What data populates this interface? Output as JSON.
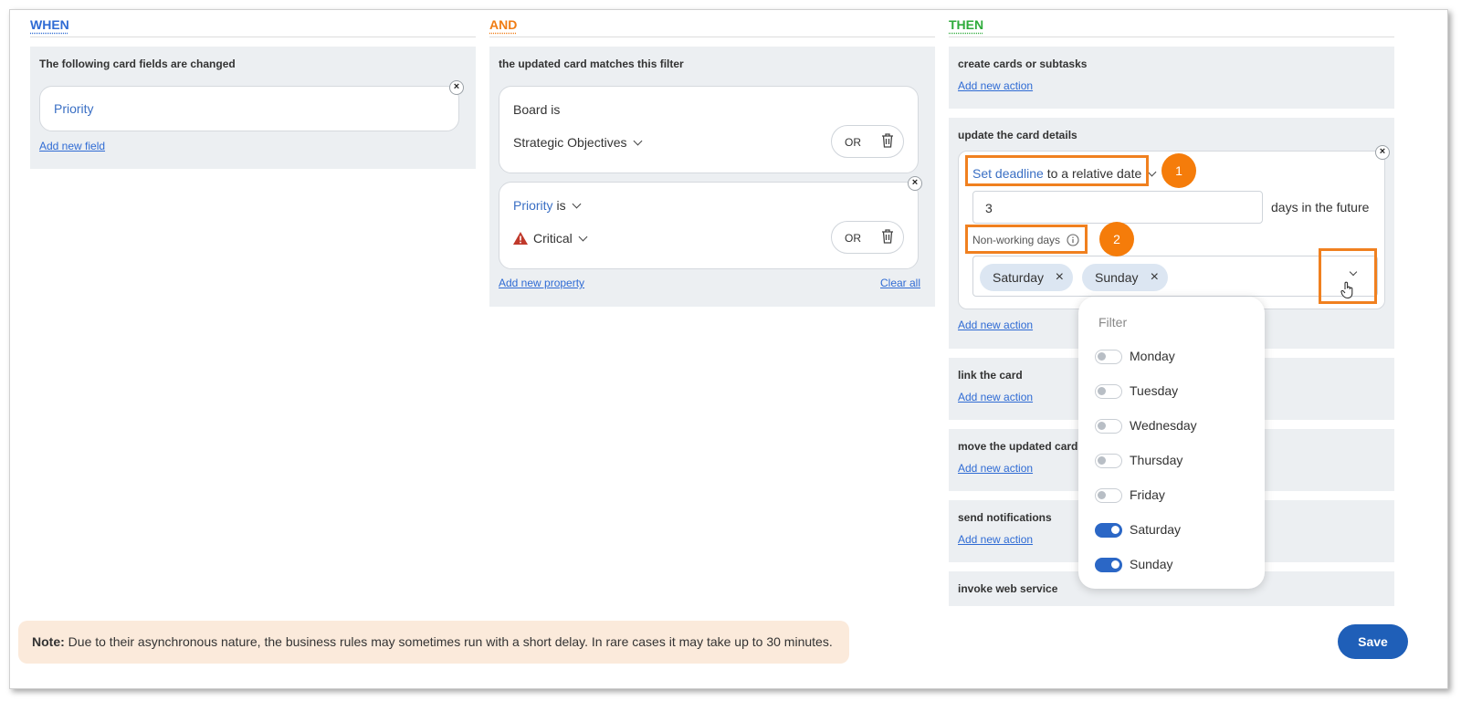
{
  "columns": {
    "when": {
      "title": "WHEN",
      "color": "#2f6bd4"
    },
    "and": {
      "title": "AND",
      "color": "#f07c14"
    },
    "then": {
      "title": "THEN",
      "color": "#2eab3b"
    }
  },
  "when_section": {
    "label": "The following card fields are changed",
    "field_value": "Priority",
    "add_link": "Add new field"
  },
  "and_section": {
    "label": "the updated card matches this filter",
    "filter1": {
      "title": "Board is",
      "value": "Strategic Objectives",
      "or_label": "OR"
    },
    "filter2": {
      "title_key": "Priority",
      "title_suffix": "is",
      "value": "Critical",
      "or_label": "OR"
    },
    "add_link": "Add new property",
    "clear_link": "Clear all"
  },
  "then_section": {
    "create": {
      "label": "create cards or subtasks",
      "link": "Add new action"
    },
    "update": {
      "label": "update the card details",
      "action_key": "Set deadline",
      "action_suffix": "to a relative date",
      "days_value": "3",
      "days_suffix": "days in the future",
      "nonworking_label": "Non-working days",
      "selected_days": [
        "Saturday",
        "Sunday"
      ],
      "link": "Add new action"
    },
    "link_card": {
      "label": "link the card",
      "link": "Add new action"
    },
    "move": {
      "label": "move the updated card",
      "link": "Add new action"
    },
    "notify": {
      "label": "send notifications",
      "link": "Add new action"
    },
    "webservice": {
      "label": "invoke web service"
    }
  },
  "badges": [
    "1",
    "2"
  ],
  "dropdown": {
    "filter_placeholder": "Filter",
    "days": [
      {
        "label": "Monday",
        "on": false
      },
      {
        "label": "Tuesday",
        "on": false
      },
      {
        "label": "Wednesday",
        "on": false
      },
      {
        "label": "Thursday",
        "on": false
      },
      {
        "label": "Friday",
        "on": false
      },
      {
        "label": "Saturday",
        "on": true
      },
      {
        "label": "Sunday",
        "on": true
      }
    ]
  },
  "note": {
    "bold": "Note:",
    "text": "Due to their asynchronous nature, the business rules may sometimes run with a short delay. In rare cases it may take up to 30 minutes."
  },
  "save_label": "Save",
  "colors": {
    "accent_orange": "#f57c0a",
    "primary_blue": "#1f5fb8",
    "critical_red": "#c0392b"
  }
}
